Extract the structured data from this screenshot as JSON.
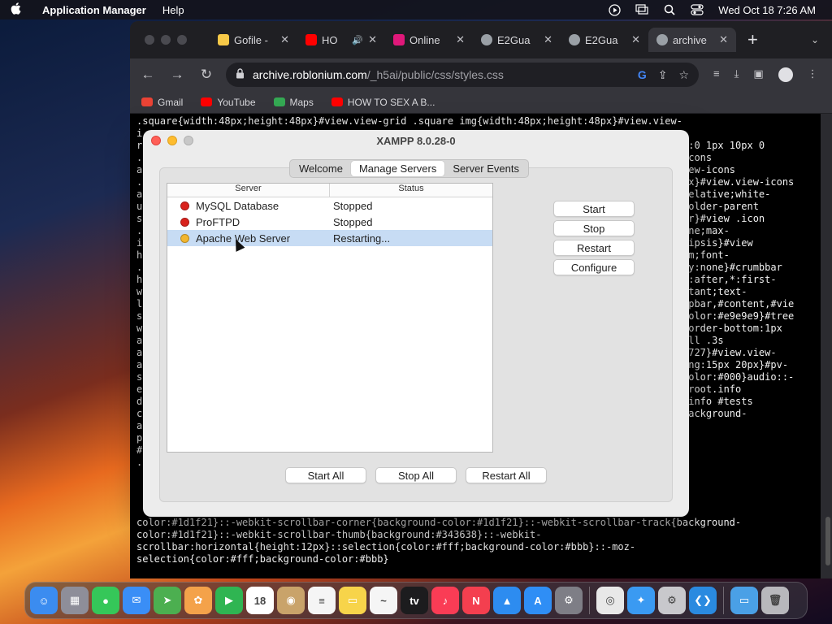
{
  "menubar": {
    "app_name": "Application Manager",
    "menus": [
      "Help"
    ],
    "clock": "Wed Oct 18  7:26 AM"
  },
  "browser": {
    "tabs": [
      {
        "title": "Gofile -",
        "favicon_color": "#f7c948"
      },
      {
        "title": "HO",
        "favicon_color": "#ff0000"
      },
      {
        "title": "Online",
        "favicon_color": "#e0187a"
      },
      {
        "title": "E2Gua",
        "favicon_color": "#9aa0a6"
      },
      {
        "title": "E2Gua",
        "favicon_color": "#9aa0a6"
      },
      {
        "title": "archive",
        "favicon_color": "#9aa0a6"
      }
    ],
    "url_host": "archive.roblonium.com",
    "url_path": "/_h5ai/public/css/styles.css",
    "bookmarks": [
      {
        "label": "Gmail",
        "color": "#ea4335"
      },
      {
        "label": "YouTube",
        "color": "#ff0000"
      },
      {
        "label": "Maps",
        "color": "#34a853"
      },
      {
        "label": "HOW TO SEX A B...",
        "color": "#ff0000"
      }
    ]
  },
  "code": {
    "full_lines": [
      ".square{width:48px;height:48px}#view.view-grid .square img{width:48px;height:48px}#view.view-"
    ],
    "left_lines": [
      "i",
      "r",
      ".",
      "a",
      ".",
      "a",
      "u",
      "s",
      ".",
      "i",
      "h",
      ".",
      "h",
      "w",
      "l",
      "s",
      "w",
      "a",
      "a",
      "a",
      "s",
      "e",
      "d",
      "c",
      "a",
      "p",
      "#",
      "."
    ],
    "right_lines": [
      "w:0 1px 10px 0",
      "icons",
      "iew-icons",
      "",
      "px}#view.view-icons",
      "",
      "",
      "relative;white-",
      "folder-parent",
      "er}#view .icon",
      "one;max-",
      "lipsis}#view",
      "",
      "em;font-",
      "ay:none}#crumbbar",
      "*:after,*:first-",
      "rtant;text-",
      "opbar,#content,#vie",
      "",
      "",
      "color:#e9e9e9}#tree",
      "border-bottom:1px",
      "all .3s",
      "2727}#view.view-",
      "ing:15px 20px}#pv-",
      "",
      "color:#000}audio::-",
      "#root.info",
      ".info #tests",
      "background-"
    ],
    "bottom_lines": [
      "color:#1d1f21}::-webkit-scrollbar-corner{background-color:#1d1f21}::-webkit-scrollbar-track{background-",
      "color:#1d1f21}::-webkit-scrollbar-thumb{background:#343638}::-webkit-",
      "scrollbar:horizontal{height:12px}::selection{color:#fff;background-color:#bbb}::-moz-",
      "selection{color:#fff;background-color:#bbb}"
    ]
  },
  "xampp": {
    "title": "XAMPP 8.0.28-0",
    "tabs": [
      {
        "label": "Welcome",
        "active": false
      },
      {
        "label": "Manage Servers",
        "active": true
      },
      {
        "label": "Server Events",
        "active": false
      }
    ],
    "columns": {
      "server": "Server",
      "status": "Status"
    },
    "servers": [
      {
        "name": "MySQL Database",
        "status": "Stopped",
        "dot_color": "#d9221c",
        "selected": false
      },
      {
        "name": "ProFTPD",
        "status": "Stopped",
        "dot_color": "#d9221c",
        "selected": false
      },
      {
        "name": "Apache Web Server",
        "status": "Restarting...",
        "dot_color": "#f2b62f",
        "selected": true
      }
    ],
    "side_buttons": {
      "start": "Start",
      "stop": "Stop",
      "restart": "Restart",
      "configure": "Configure"
    },
    "bottom_buttons": {
      "start_all": "Start All",
      "stop_all": "Stop All",
      "restart_all": "Restart All"
    }
  },
  "dock": {
    "apps": [
      {
        "name": "finder-icon",
        "color": "#3b8cf0",
        "glyph": "☺"
      },
      {
        "name": "launchpad-icon",
        "color": "#8e8e99",
        "glyph": "▦"
      },
      {
        "name": "messages-icon",
        "color": "#35c759",
        "glyph": "●"
      },
      {
        "name": "mail-icon",
        "color": "#3a8ef6",
        "glyph": "✉"
      },
      {
        "name": "maps-icon",
        "color": "#4caf50",
        "glyph": "➤"
      },
      {
        "name": "photos-icon",
        "color": "#f4a24a",
        "glyph": "✿"
      },
      {
        "name": "facetime-icon",
        "color": "#2fb552",
        "glyph": "▶"
      },
      {
        "name": "calendar-icon",
        "color": "#ffffff",
        "glyph": "18"
      },
      {
        "name": "contacts-icon",
        "color": "#c9a36a",
        "glyph": "◉"
      },
      {
        "name": "reminders-icon",
        "color": "#f5f5f5",
        "glyph": "≡"
      },
      {
        "name": "notes-icon",
        "color": "#f7d44a",
        "glyph": "▭"
      },
      {
        "name": "freeform-icon",
        "color": "#f5f5f5",
        "glyph": "~"
      },
      {
        "name": "tv-icon",
        "color": "#1c1c1e",
        "glyph": "tv"
      },
      {
        "name": "music-icon",
        "color": "#fa3c55",
        "glyph": "♪"
      },
      {
        "name": "news-icon",
        "color": "#f43f4f",
        "glyph": "N"
      },
      {
        "name": "keynote-icon",
        "color": "#2d8cf0",
        "glyph": "▲"
      },
      {
        "name": "app-store-icon",
        "color": "#2f8ef5",
        "glyph": "A"
      },
      {
        "name": "system-settings-icon",
        "color": "#7e7e86",
        "glyph": "⚙"
      }
    ],
    "recent": [
      {
        "name": "chrome-icon",
        "color": "#e8e8e8",
        "glyph": "◎"
      },
      {
        "name": "safari-icon",
        "color": "#3a9af2",
        "glyph": "✦"
      },
      {
        "name": "xampp-app-icon",
        "color": "#c8c8cc",
        "glyph": "⚙"
      },
      {
        "name": "vscode-icon",
        "color": "#2a8ae0",
        "glyph": "❮❯"
      }
    ],
    "trailing": [
      {
        "name": "downloads-folder-icon",
        "color": "#4aa0e6",
        "glyph": "▭"
      },
      {
        "name": "trash-icon",
        "color": "#b8b8bc",
        "glyph": "🗑"
      }
    ]
  }
}
